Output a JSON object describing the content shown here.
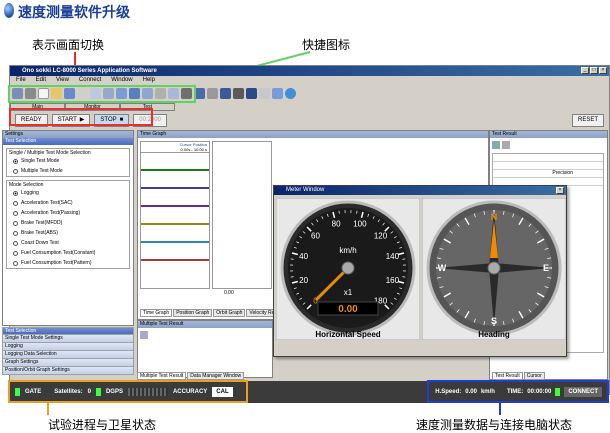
{
  "page_title": "速度测量软件升级",
  "annotations": {
    "display_switch": "表示画面切换",
    "shortcut_icons": "快捷图标",
    "test_progress": "试验进程与卫星状态",
    "speed_data": "速度测量数据与连接电脑状态"
  },
  "window": {
    "title": "Ono sokki LC-8000 Series Application Software",
    "menu": [
      "File",
      "Edit",
      "View",
      "Connect",
      "Window",
      "Help"
    ]
  },
  "mode_tabs": [
    "Main",
    "Monitor",
    "Test"
  ],
  "controls": {
    "ready": "READY",
    "start": "START",
    "stop": "STOP",
    "timer": "00:2000",
    "reset": "RESET"
  },
  "settings": {
    "header": "Settings",
    "subheader": "Test Selection",
    "single_multi_label": "Single / Multiple Test Mode Selection",
    "single_multi": [
      {
        "label": "Single Test Mode",
        "on": true
      },
      {
        "label": "Multiple Test Mode",
        "on": false
      }
    ],
    "mode_label": "Mode Selection",
    "modes": [
      {
        "label": "Logging",
        "on": true
      },
      {
        "label": "Acceleration Test(SAC)",
        "on": false
      },
      {
        "label": "Acceleration Test(Passing)",
        "on": false
      },
      {
        "label": "Brake Test(MFDD)",
        "on": false
      },
      {
        "label": "Brake Test(ABS)",
        "on": false
      },
      {
        "label": "Coast Down Test",
        "on": false
      },
      {
        "label": "Fuel Consumption Test(Constant)",
        "on": false
      },
      {
        "label": "Fuel Consumption Test(Pattern)",
        "on": false
      }
    ],
    "nav_tabs": [
      {
        "label": "Test Selection",
        "sel": true
      },
      {
        "label": "Single Test Mode Settings",
        "sel": false
      },
      {
        "label": "Logging",
        "sel": false
      },
      {
        "label": "Logging Data Selection",
        "sel": false
      },
      {
        "label": "Graph Settings",
        "sel": false
      },
      {
        "label": "Position/Orbit Graph Settings",
        "sel": false
      }
    ]
  },
  "graph": {
    "header": "Time Graph",
    "cursor_label": "Cursor Position",
    "cursor_value": "0.00s - 10.00 s",
    "tabs": [
      "Time Graph",
      "Position Graph",
      "Orbit Graph",
      "Velocity Report"
    ],
    "x_start": "0.00",
    "bottom_header": "Multiple Test Result",
    "bottom_tabs": [
      "Multiple Test Result",
      "Data Manager Window"
    ]
  },
  "result": {
    "header": "Test Result",
    "precision": "Precision",
    "tabs": [
      "Test Result",
      "Cursor"
    ]
  },
  "meter": {
    "title": "Meter Window",
    "speedo": {
      "ticks": [
        "0",
        "20",
        "40",
        "60",
        "80",
        "100",
        "120",
        "140",
        "160",
        "180"
      ],
      "unit": "km/h",
      "mult": "x1",
      "value": "0.00",
      "label": "Horizontal Speed",
      "speed_value": 0
    },
    "compass": {
      "n": "N",
      "s": "S",
      "e": "E",
      "w": "W",
      "label": "Heading"
    }
  },
  "status": {
    "gate": "GATE",
    "satellites_label": "Satellites:",
    "satellites_value": "0",
    "dgps": "DGPS",
    "accuracy": "ACCURACY",
    "cal": "CAL",
    "hspeed_label": "H.Speed:",
    "hspeed_value": "0.00",
    "hspeed_unit": "km/h",
    "time_label": "TIME:",
    "time_value": "00:00:00",
    "connect": "CONNECT"
  },
  "colors": {
    "title_blue": "#1a3f9c",
    "green_box": "#5fd35f",
    "red_box": "#e53030",
    "orange_box": "#e8a020",
    "blue_box": "#1f3fd0",
    "needle": "#f08a00"
  }
}
